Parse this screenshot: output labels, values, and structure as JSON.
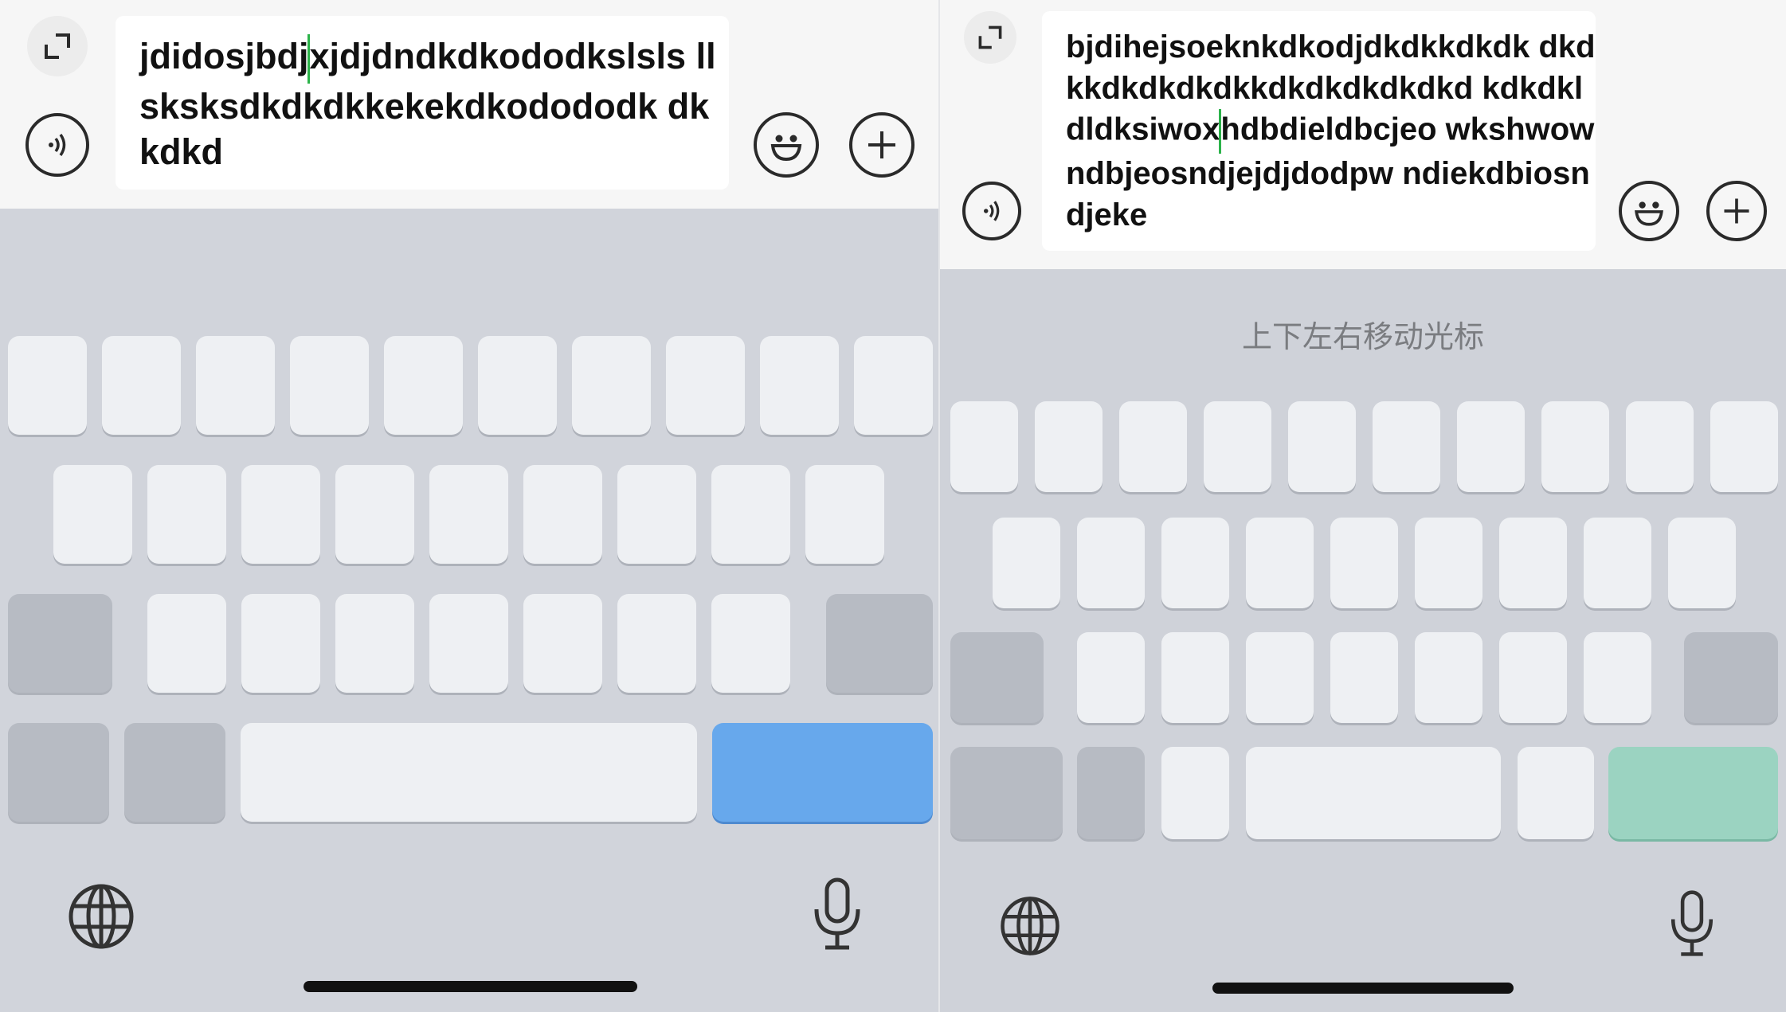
{
  "left": {
    "text_before_caret": "jdidosjbdj",
    "text_after_caret": "xjdjdndkdkododkslsls llsksksdkdkdkkekekdkodododk dkkdkd",
    "return_key_color": "#67a8ec",
    "icons": {
      "expand": "expand-icon",
      "voice": "voice-icon",
      "emoji": "emoji-icon",
      "add": "plus-icon",
      "globe": "globe-icon",
      "mic": "microphone-icon"
    }
  },
  "right": {
    "text_before_caret": "bjdihejsoeknkdkodjdkdkkdkdk dkdkkdkdkdkdkkdkdkdkdkdkd kdkdkldldksiwox",
    "text_after_caret": "hdbdieldbcjeo wkshwowndbjeosndjejdjdodpw ndiekdbiosndjeke",
    "hint": "上下左右移动光标",
    "return_key_color": "#9bd3c1",
    "icons": {
      "expand": "expand-icon",
      "voice": "voice-icon",
      "emoji": "emoji-icon",
      "add": "plus-icon",
      "globe": "globe-icon",
      "mic": "microphone-icon"
    }
  },
  "colors": {
    "caret": "#2cb34a",
    "keyboard_bg": "#d1d4db",
    "key": "#eef0f3"
  }
}
